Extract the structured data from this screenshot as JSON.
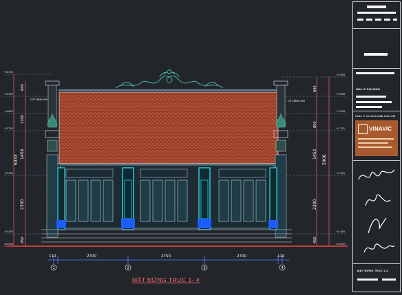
{
  "drawing": {
    "caption": "MẶT ĐỨNG TRỤC 1- 4",
    "project_name": "NHÀ Ở GIA ĐÌNH",
    "sheet_title": "MẶT ĐỨNG TRỤC 1-4",
    "company_logo_text": "VINAVIC",
    "company_name_line": "CÔNG TY CỔ PHẦN KIẾN TRÚC VIỆT",
    "level_label_left": "CỐT ĐỈNH MÁI",
    "colors": {
      "background": "#22262b",
      "roof": "#a7452e",
      "column_cyan": "#2fd6e6",
      "column_blue": "#1e5cff",
      "line_red": "#ff4040",
      "dim_blue": "#5a7dff"
    }
  },
  "dimensions": {
    "bottom": [
      "110",
      "2700",
      "2750",
      "2700",
      "110"
    ],
    "left_total": "6333",
    "left_upper": "1454",
    "left_lower": "2300",
    "left_small": [
      "840",
      "1700",
      "450"
    ],
    "right_total": "5908",
    "right_upper": "1452",
    "right_lower": "2300",
    "right_small": [
      "840",
      "850",
      "450"
    ]
  },
  "axes": [
    "1",
    "2",
    "3",
    "4"
  ]
}
